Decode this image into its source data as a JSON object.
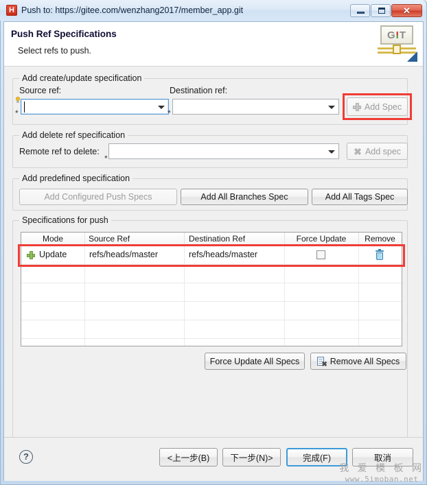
{
  "window": {
    "title": "Push to: https://gitee.com/wenzhang2017/member_app.git",
    "app_icon": "h-app-icon",
    "controls": {
      "minimize": "minimize-icon",
      "maximize": "restore-icon",
      "close": "✕"
    }
  },
  "header": {
    "title": "Push Ref Specifications",
    "subtitle": "Select refs to push.",
    "logo": {
      "g": "G",
      "i": "I",
      "t": "T"
    }
  },
  "create_update_group": {
    "title": "Add create/update specification",
    "source_label": "Source ref:",
    "destination_label": "Destination ref:",
    "source_value": "",
    "destination_value": "",
    "add_spec_label": "Add Spec",
    "add_spec_enabled": false
  },
  "delete_group": {
    "title": "Add delete ref specification",
    "remote_label": "Remote ref to delete:",
    "remote_value": "",
    "add_spec_label": "Add spec",
    "add_spec_enabled": false
  },
  "predefined_group": {
    "title": "Add predefined specification",
    "buttons": [
      {
        "label": "Add Configured Push Specs",
        "enabled": false
      },
      {
        "label": "Add All Branches Spec",
        "enabled": true
      },
      {
        "label": "Add All Tags Spec",
        "enabled": true
      }
    ]
  },
  "specs_group": {
    "title": "Specifications for push",
    "columns": [
      "Mode",
      "Source Ref",
      "Destination Ref",
      "Force Update",
      "Remove"
    ],
    "rows": [
      {
        "mode_icon": "green-plus-icon",
        "mode": "Update",
        "source_ref": "refs/heads/master",
        "destination_ref": "refs/heads/master",
        "force_update": false,
        "remove_icon": "trash-icon"
      }
    ],
    "empty_row_count": 6,
    "force_update_all_label": "Force Update All Specs",
    "remove_all_label": "Remove All Specs"
  },
  "footer": {
    "help": "?",
    "back": "<上一步(B)",
    "next": "下一步(N)>",
    "finish": "完成(F)",
    "cancel": "取消",
    "default_button": "finish"
  },
  "watermark": {
    "line1": "我 爱 模 板 网",
    "line2": "www.5imoban.net"
  },
  "colors": {
    "annotation": "#f03c35",
    "accent": "#3c9ad8",
    "close_button": "#cd3d28"
  }
}
